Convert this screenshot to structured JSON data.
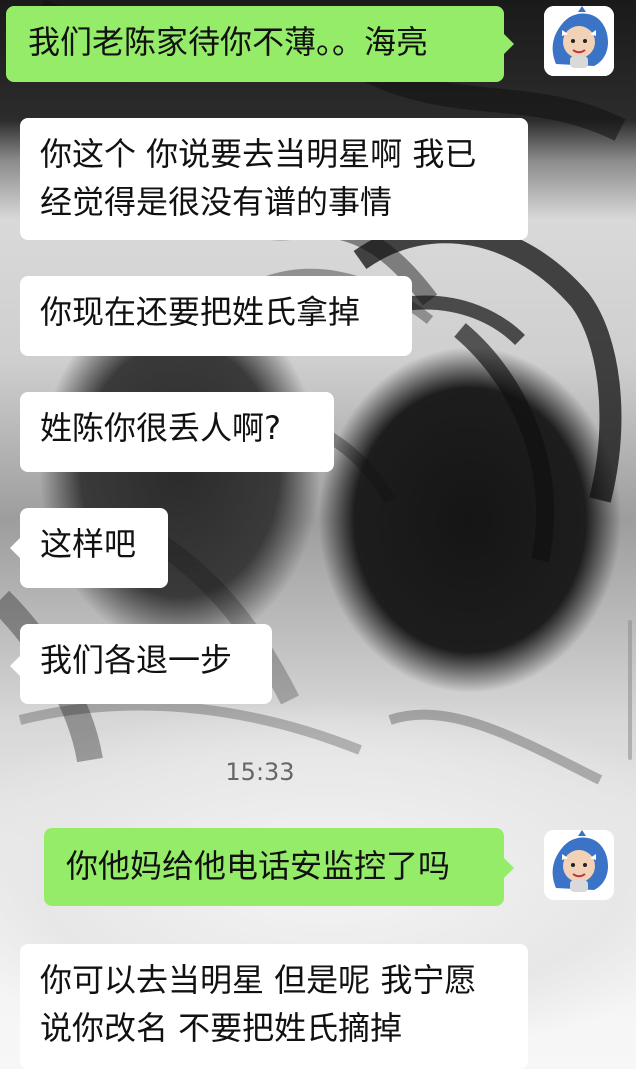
{
  "chat": {
    "messages": [
      {
        "side": "right",
        "text": "我们老陈家待你不薄。。海亮"
      },
      {
        "side": "left",
        "text": "你这个 你说要去当明星啊 我已"
      },
      {
        "side": "left",
        "text": "经觉得是很没有谱的事情"
      },
      {
        "side": "left",
        "text": "你现在还要把姓氏拿掉"
      },
      {
        "side": "left",
        "text": "姓陈你很丢人啊?"
      },
      {
        "side": "left",
        "text": "这样吧"
      },
      {
        "side": "left",
        "text": "我们各退一步"
      },
      {
        "side": "right",
        "text": "你他妈给他电话安监控了吗"
      },
      {
        "side": "left",
        "text": "你可以去当明星 但是呢 我宁愿"
      },
      {
        "side": "left",
        "text": "说你改名 不要把姓氏摘掉"
      }
    ],
    "timestamp": "15:33"
  },
  "icons": {
    "avatar": "shark-hood-avatar-icon"
  },
  "colors": {
    "left_bubble": "#ffffff",
    "right_bubble": "#95ec69",
    "text": "#111111"
  }
}
